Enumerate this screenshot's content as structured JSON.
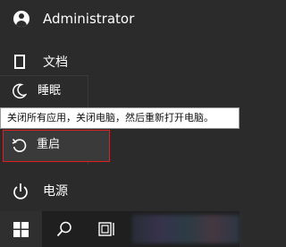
{
  "user": {
    "name": "Administrator",
    "icon": "user-avatar-icon"
  },
  "documents": {
    "label": "文档",
    "icon": "document-icon"
  },
  "power_menu": {
    "sleep": {
      "label": "睡眠",
      "icon": "moon-icon"
    },
    "restart": {
      "label": "重启",
      "icon": "restart-icon",
      "highlight_color": "#e02020"
    },
    "tooltip": "关闭所有应用，关闭电脑，然后重新打开电脑。"
  },
  "power": {
    "label": "电源",
    "icon": "power-icon"
  },
  "taskbar": {
    "start_icon": "windows-logo-icon",
    "search_icon": "search-icon",
    "task_view_icon": "task-view-icon"
  },
  "colors": {
    "menu_bg": "#2b2b2b",
    "taskbar_bg": "#1f1f1f",
    "tooltip_bg": "#ffffff"
  }
}
